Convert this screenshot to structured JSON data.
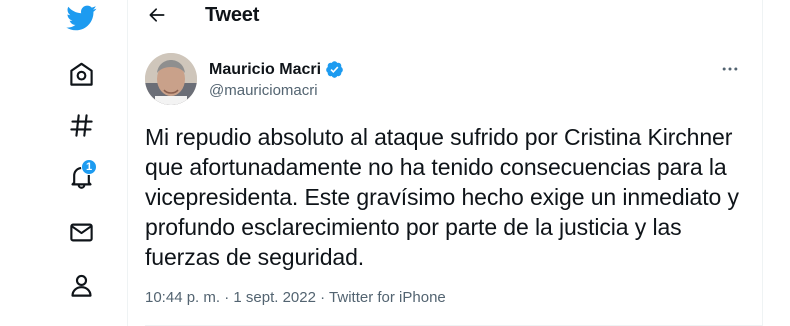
{
  "colors": {
    "accent": "#1d9bf0",
    "text": "#0f1419",
    "secondary_text": "#536471"
  },
  "sidebar": {
    "items": [
      {
        "name": "twitter-logo",
        "icon": "twitter-bird-icon"
      },
      {
        "name": "home",
        "icon": "home-icon"
      },
      {
        "name": "explore",
        "icon": "hashtag-icon"
      },
      {
        "name": "notifications",
        "icon": "bell-icon",
        "badge": "1"
      },
      {
        "name": "messages",
        "icon": "envelope-icon"
      },
      {
        "name": "profile",
        "icon": "person-icon"
      }
    ]
  },
  "header": {
    "title": "Tweet",
    "back_icon": "back-arrow-icon"
  },
  "tweet": {
    "author": {
      "display_name": "Mauricio Macri",
      "handle": "@mauriciomacri",
      "verified": true
    },
    "text": "Mi repudio absoluto al ataque sufrido por Cristina Kirchner que afortunadamente no ha tenido consecuencias para la vicepresidenta. Este gravísimo hecho exige un inmediato y profundo esclarecimiento por parte de la justicia y las fuerzas de seguridad.",
    "time": "10:44 p. m.",
    "separator": "·",
    "date": "1 sept. 2022",
    "source": "Twitter for iPhone"
  }
}
